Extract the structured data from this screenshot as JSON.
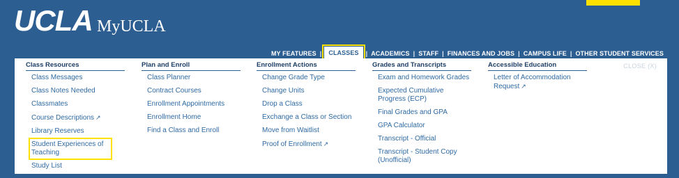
{
  "header": {
    "logo": "UCLA",
    "title": "MyUCLA"
  },
  "nav": {
    "items": [
      "MY FEATURES",
      "CLASSES",
      "ACADEMICS",
      "STAFF",
      "FINANCES AND JOBS",
      "CAMPUS LIFE",
      "OTHER STUDENT SERVICES"
    ],
    "active": "CLASSES"
  },
  "menu": {
    "close_label": "CLOSE (X)",
    "columns": [
      {
        "heading": "Class Resources",
        "items": [
          "Class Messages",
          "Class Notes Needed",
          "Classmates",
          "Course Descriptions",
          "Library Reserves",
          "Student Experiences of Teaching",
          "Study List"
        ]
      },
      {
        "heading": "Plan and Enroll",
        "items": [
          "Class Planner",
          "Contract Courses",
          "Enrollment Appointments",
          "Enrollment Home",
          "Find a Class and Enroll"
        ]
      },
      {
        "heading": "Enrollment Actions",
        "items": [
          "Change Grade Type",
          "Change Units",
          "Drop a Class",
          "Exchange a Class or Section",
          "Move from Waitlist",
          "Proof of Enrollment"
        ]
      },
      {
        "heading": "Grades and Transcripts",
        "items": [
          "Exam and Homework Grades",
          "Expected Cumulative Progress (ECP)",
          "Final Grades and GPA",
          "GPA Calculator",
          "Transcript - Official",
          "Transcript - Student Copy (Unofficial)"
        ]
      },
      {
        "heading": "Accessible Education",
        "items": [
          "Letter of Accommodation Request"
        ]
      }
    ]
  },
  "colors": {
    "background": "#2c5e91",
    "highlight": "#ffe100",
    "link": "#2f6aa3"
  }
}
